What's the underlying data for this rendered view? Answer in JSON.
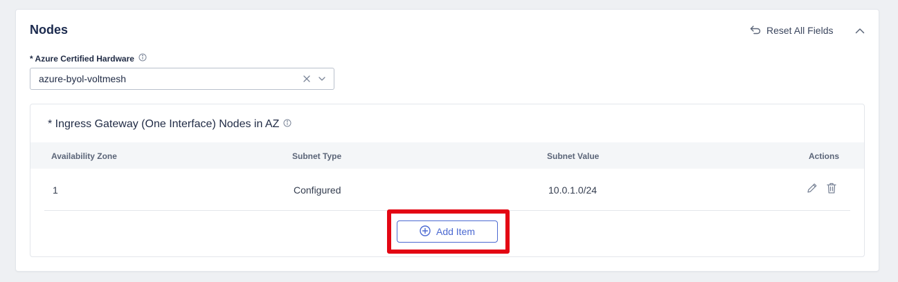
{
  "section": {
    "title": "Nodes",
    "reset_label": "Reset All Fields"
  },
  "hardware": {
    "label": "* Azure Certified Hardware",
    "value": "azure-byol-voltmesh"
  },
  "nodes_table": {
    "title": "* Ingress Gateway (One Interface) Nodes in AZ",
    "columns": [
      "Availability Zone",
      "Subnet Type",
      "Subnet Value",
      "Actions"
    ],
    "rows": [
      {
        "zone": "1",
        "subnet_type": "Configured",
        "subnet_value": "10.0.1.0/24"
      }
    ],
    "add_item_label": "Add Item"
  },
  "colors": {
    "accent": "#4a68d1",
    "highlight": "#e30613",
    "heading": "#1b2a4e"
  }
}
